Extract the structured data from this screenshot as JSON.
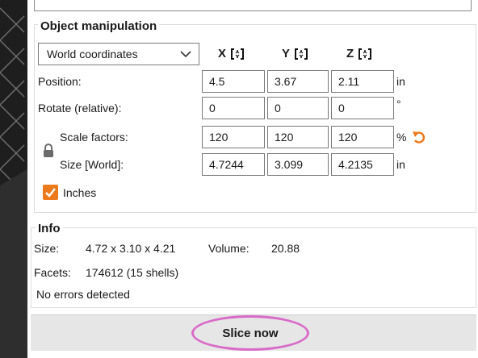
{
  "object_manipulation": {
    "title": "Object manipulation",
    "coordinate_system": "World coordinates",
    "axes": [
      "X",
      "Y",
      "Z"
    ],
    "position": {
      "label": "Position:",
      "values": [
        "4.5",
        "3.67",
        "2.11"
      ],
      "unit": "in"
    },
    "rotate": {
      "label": "Rotate (relative):",
      "values": [
        "0",
        "0",
        "0"
      ],
      "unit": "°"
    },
    "scale": {
      "label": "Scale factors:",
      "values": [
        "120",
        "120",
        "120"
      ],
      "unit": "%"
    },
    "size": {
      "label": "Size [World]:",
      "values": [
        "4.7244",
        "3.099",
        "4.2135"
      ],
      "unit": "in"
    },
    "inches": {
      "label": "Inches",
      "checked": true
    }
  },
  "info": {
    "title": "Info",
    "size_label": "Size:",
    "size_value": "4.72 x 3.10 x 4.21",
    "volume_label": "Volume:",
    "volume_value": "20.88",
    "facets_label": "Facets:",
    "facets_value": "174612 (15 shells)",
    "errors": "No errors detected"
  },
  "slice_button": "Slice now",
  "colors": {
    "accent": "#ec7a1c",
    "highlight_circle": "#d96bc8"
  },
  "icons": [
    "chevron-down-icon",
    "axis-drag-icon",
    "lock-icon",
    "reset-arrow-icon",
    "checkmark-icon"
  ]
}
